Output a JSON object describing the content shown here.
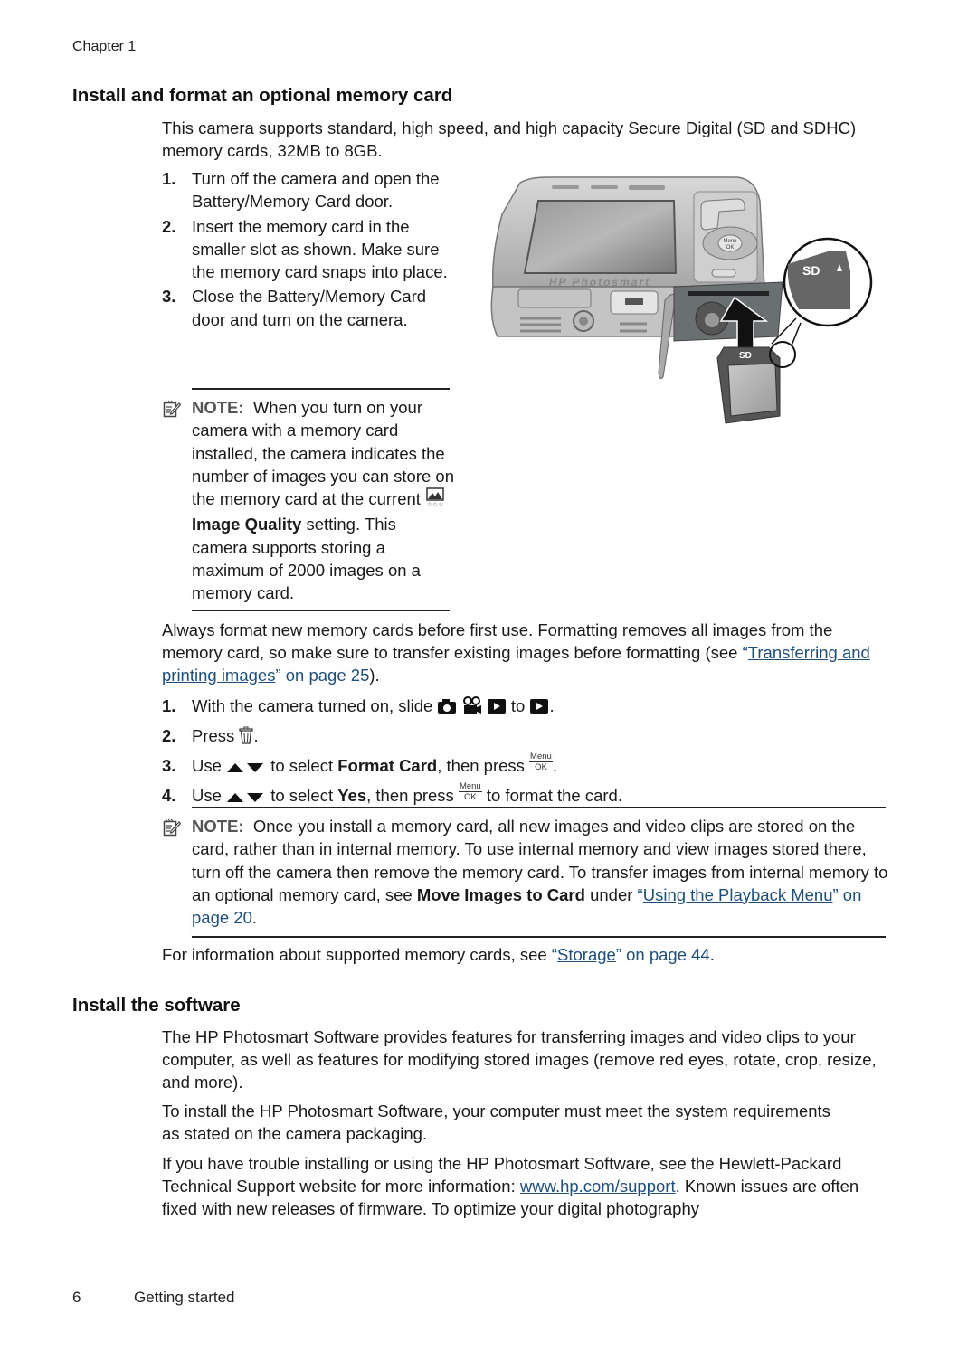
{
  "header": {
    "chapter": "Chapter 1"
  },
  "section1": {
    "title": "Install and format an optional memory card",
    "intro": "This camera supports standard, high speed, and high capacity Secure Digital (SD and SDHC) memory cards, 32MB to 8GB.",
    "steps": [
      {
        "num": "1.",
        "text": "Turn off the camera and open the Battery/Memory Card door."
      },
      {
        "num": "2.",
        "text": "Insert the memory card in the smaller slot as shown. Make sure the memory card snaps into place."
      },
      {
        "num": "3.",
        "text": "Close the Battery/Memory Card door and turn on the camera."
      }
    ],
    "note1": {
      "label": "NOTE:",
      "text_before": "When you turn on your camera with a memory card installed, the camera indicates the number of images you can store on the memory card at the current",
      "bold": "Image Quality",
      "text_after": "setting. This camera supports storing a maximum of 2000 images on a memory card."
    },
    "illustration": {
      "brand_text": "HP Photosmart",
      "button_label_top": "Menu",
      "button_label_bottom": "OK",
      "card_label": "SD"
    },
    "format_para": {
      "text": "Always format new memory cards before first use. Formatting removes all images from the memory card, so make sure to transfer existing images before formatting (see ",
      "link_text": "Transferring and printing images",
      "link_suffix": " on page 25",
      "close": ")."
    },
    "format_steps": [
      {
        "num": "1.",
        "pre": "With the camera turned on, slide",
        "mid": "to",
        "post": "."
      },
      {
        "num": "2.",
        "pre": "Press",
        "post": "."
      },
      {
        "num": "3.",
        "pre": "Use",
        "mid1": "to select",
        "bold": "Format Card",
        "mid2": ", then press",
        "post": "."
      },
      {
        "num": "4.",
        "pre": "Use",
        "mid1": "to select",
        "bold": "Yes",
        "mid2": ", then press",
        "post": "to format the card."
      }
    ],
    "menu_ok": {
      "top": "Menu",
      "bottom": "OK"
    },
    "note2": {
      "label": "NOTE:",
      "text": "Once you install a memory card, all new images and video clips are stored on the card, rather than in internal memory. To use internal memory and view images stored there, turn off the camera then remove the memory card. To transfer images from internal memory to an optional memory card, see",
      "bold": "Move Images to Card",
      "under": "under ",
      "link_text": "Using the Playback Menu",
      "link_suffix": " on page 20",
      "close": "."
    },
    "storage_para": {
      "text": "For information about supported memory cards, see ",
      "link_text": "Storage",
      "link_suffix": " on page 44",
      "close": "."
    }
  },
  "section2": {
    "title": "Install the software",
    "para1": "The HP Photosmart Software provides features for transferring images and video clips to your computer, as well as features for modifying stored images (remove red eyes, rotate, crop, resize, and more).",
    "para2": "To install the HP Photosmart Software, your computer must meet the system requirements as stated on the camera packaging.",
    "para3_before": "If you have trouble installing or using the HP Photosmart Software, see the Hewlett-Packard Technical Support website for more information: ",
    "para3_link": "www.hp.com/support",
    "para3_after": ". Known issues are often fixed with new releases of firmware. To optimize your digital photography"
  },
  "footer": {
    "page_number": "6",
    "section": "Getting started"
  },
  "colors": {
    "link": "#1f4e79",
    "text": "#1a1a1a",
    "note_label": "#555555"
  },
  "icons": {
    "note": "note-pencil-icon",
    "image_quality": "image-quality-icon",
    "camera": "camera-mode-icon",
    "video": "video-mode-icon",
    "playback": "playback-icon",
    "delete": "trash-icon",
    "updown": "up-down-arrows-icon"
  }
}
